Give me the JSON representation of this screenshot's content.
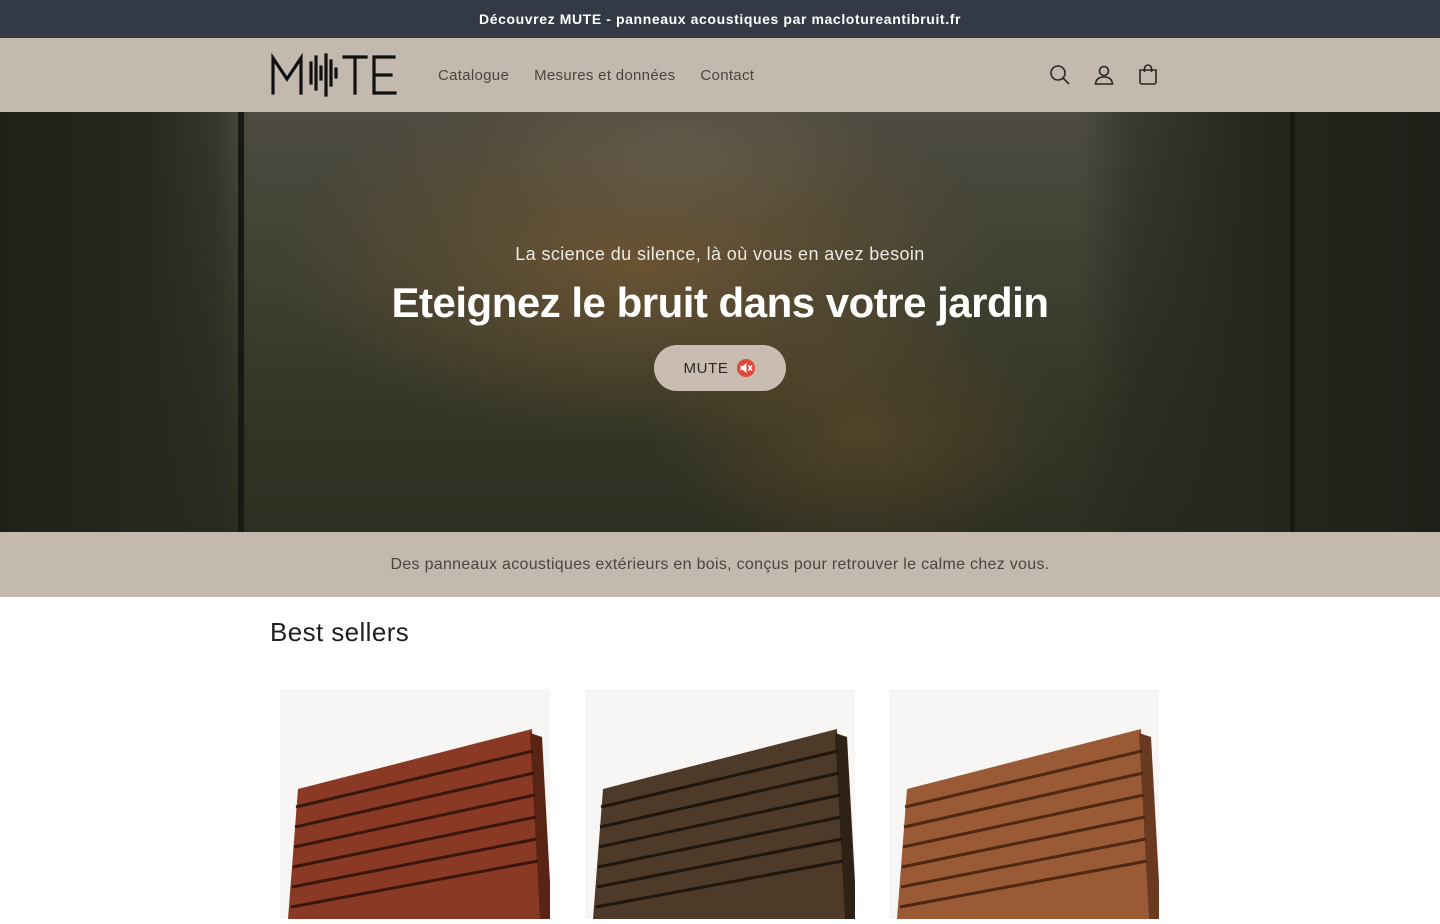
{
  "announcement": {
    "text": "Découvrez MUTE - panneaux acoustiques par maclotureantibruit.fr"
  },
  "header": {
    "logo_text": "MUTE",
    "nav": [
      "Catalogue",
      "Mesures et données",
      "Contact"
    ],
    "icons": [
      "search-icon",
      "account-icon",
      "cart-icon"
    ]
  },
  "hero": {
    "subtitle": "La science du silence, là où vous en avez besoin",
    "title": "Eteignez le bruit dans votre jardin",
    "button_label": "MUTE",
    "button_icon": "muted-speaker-icon"
  },
  "tagline": {
    "text": "Des panneaux acoustiques extérieurs en bois, conçus pour retrouver le calme chez vous."
  },
  "best_sellers": {
    "heading": "Best sellers",
    "products": [
      {
        "image": "wooden-acoustic-panel-red",
        "color": "#8a3a24"
      },
      {
        "image": "wooden-acoustic-panel-dark",
        "color": "#4d3a28"
      },
      {
        "image": "wooden-acoustic-panel-light",
        "color": "#9a5a36"
      }
    ]
  },
  "colors": {
    "header_bg": "#c4b9ae",
    "announcement_bg": "#343a45",
    "button_bg": "#c9bdb1"
  }
}
